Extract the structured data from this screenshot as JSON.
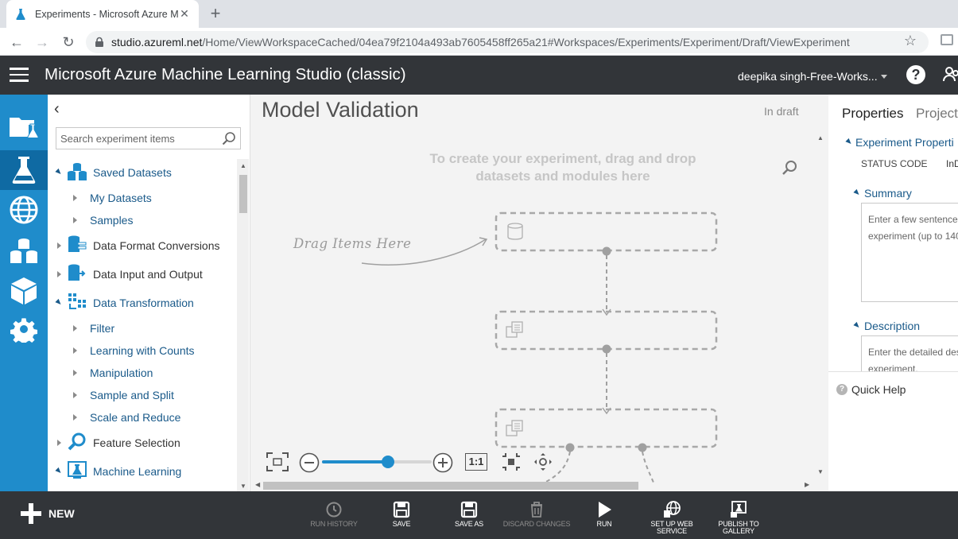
{
  "browser": {
    "tab_title": "Experiments - Microsoft Azure M",
    "url_host": "studio.azureml.net",
    "url_rest": "/Home/ViewWorkspaceCached/04ea79f2104a493ab7605458ff265a21#Workspaces/Experiments/Experiment/Draft/ViewExperiment"
  },
  "header": {
    "title": "Microsoft Azure Machine Learning Studio (classic)",
    "workspace": "deepika singh-Free-Works...",
    "help_label": "?"
  },
  "rail": {
    "items": [
      "projects-icon",
      "experiments-icon",
      "web-services-icon",
      "datasets-icon",
      "trained-models-icon",
      "settings-icon"
    ],
    "active": "experiments-icon",
    "accent": "#1f8ccb"
  },
  "palette": {
    "search_placeholder": "Search experiment items",
    "items": [
      {
        "label": "Saved Datasets",
        "level": 0,
        "expanded": true
      },
      {
        "label": "My Datasets",
        "level": 1
      },
      {
        "label": "Samples",
        "level": 1
      },
      {
        "label": "Data Format Conversions",
        "level": 0,
        "expanded": false
      },
      {
        "label": "Data Input and Output",
        "level": 0,
        "expanded": false
      },
      {
        "label": "Data Transformation",
        "level": 0,
        "expanded": true
      },
      {
        "label": "Filter",
        "level": 1
      },
      {
        "label": "Learning with Counts",
        "level": 1
      },
      {
        "label": "Manipulation",
        "level": 1
      },
      {
        "label": "Sample and Split",
        "level": 1
      },
      {
        "label": "Scale and Reduce",
        "level": 1
      },
      {
        "label": "Feature Selection",
        "level": 0,
        "expanded": false
      },
      {
        "label": "Machine Learning",
        "level": 0,
        "expanded": true
      }
    ]
  },
  "canvas": {
    "title": "Model Validation",
    "status": "In draft",
    "hint": "To create your experiment, drag and drop datasets and modules here",
    "drag_hint": "Drag Items Here",
    "zoom_one_to_one": "1:1",
    "zoom_level": 0.6
  },
  "properties": {
    "tab_properties": "Properties",
    "tab_project": "Project",
    "section_experiment": "Experiment Properti",
    "status_code_key": "STATUS CODE",
    "status_code_value": "InD",
    "section_summary": "Summary",
    "summary_placeholder": "Enter a few sentences experiment (up to 140",
    "section_description": "Description",
    "description_placeholder": "Enter the detailed des experiment.",
    "quick_help": "Quick Help"
  },
  "bottombar": {
    "new_label": "NEW",
    "commands": [
      {
        "label": "RUN HISTORY",
        "enabled": false
      },
      {
        "label": "SAVE",
        "enabled": true
      },
      {
        "label": "SAVE AS",
        "enabled": true
      },
      {
        "label": "DISCARD CHANGES",
        "enabled": false
      },
      {
        "label": "RUN",
        "enabled": true
      },
      {
        "label": "SET UP WEB",
        "label2": "SERVICE",
        "enabled": true
      },
      {
        "label": "PUBLISH TO",
        "label2": "GALLERY",
        "enabled": true
      }
    ]
  }
}
